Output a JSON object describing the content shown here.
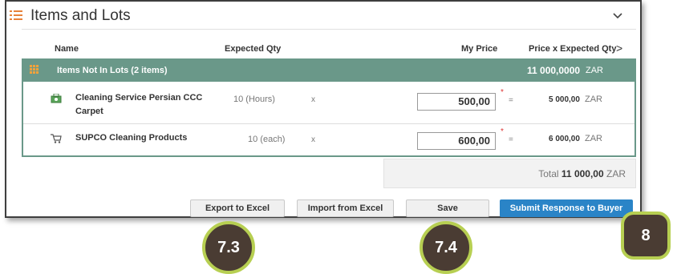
{
  "section": {
    "title": "Items and Lots",
    "collapse_icon": "chevron-down-icon",
    "menu_icon": "list-icon"
  },
  "columns": {
    "name": "Name",
    "expected_qty": "Expected Qty",
    "my_price": "My Price",
    "price_x_qty": "Price x Expected Qty",
    "more": ">"
  },
  "group": {
    "label": "Items Not In Lots (2 items)",
    "total": "11 000,0000",
    "currency": "ZAR",
    "icon": "grid-icon"
  },
  "items": [
    {
      "name_line1": "Cleaning Service Persian CCC",
      "name_line2": "Carpet",
      "qty": "10 (Hours)",
      "times": "x",
      "price": "500,00",
      "required": "*",
      "equals": "=",
      "line_total": "5 000,00",
      "currency": "ZAR",
      "icon": "service-icon"
    },
    {
      "name_line1": "SUPCO Cleaning Products",
      "qty": "10 (each)",
      "times": "x",
      "price": "600,00",
      "required": "*",
      "equals": "=",
      "line_total": "6 000,00",
      "currency": "ZAR",
      "icon": "cart-icon"
    }
  ],
  "total": {
    "label": "Total",
    "value": "11 000,00",
    "currency": "ZAR"
  },
  "buttons": {
    "export": "Export to Excel",
    "import": "Import from Excel",
    "save": "Save",
    "submit": "Submit Response to Buyer"
  },
  "callouts": {
    "export": "7.3",
    "save": "7.4",
    "submit": "8"
  },
  "colors": {
    "group_bg": "#6a9889",
    "accent_orange": "#e8823a",
    "primary_button": "#2a84c7",
    "callout_fill": "#4a3c33",
    "callout_border": "#b7cf52"
  }
}
